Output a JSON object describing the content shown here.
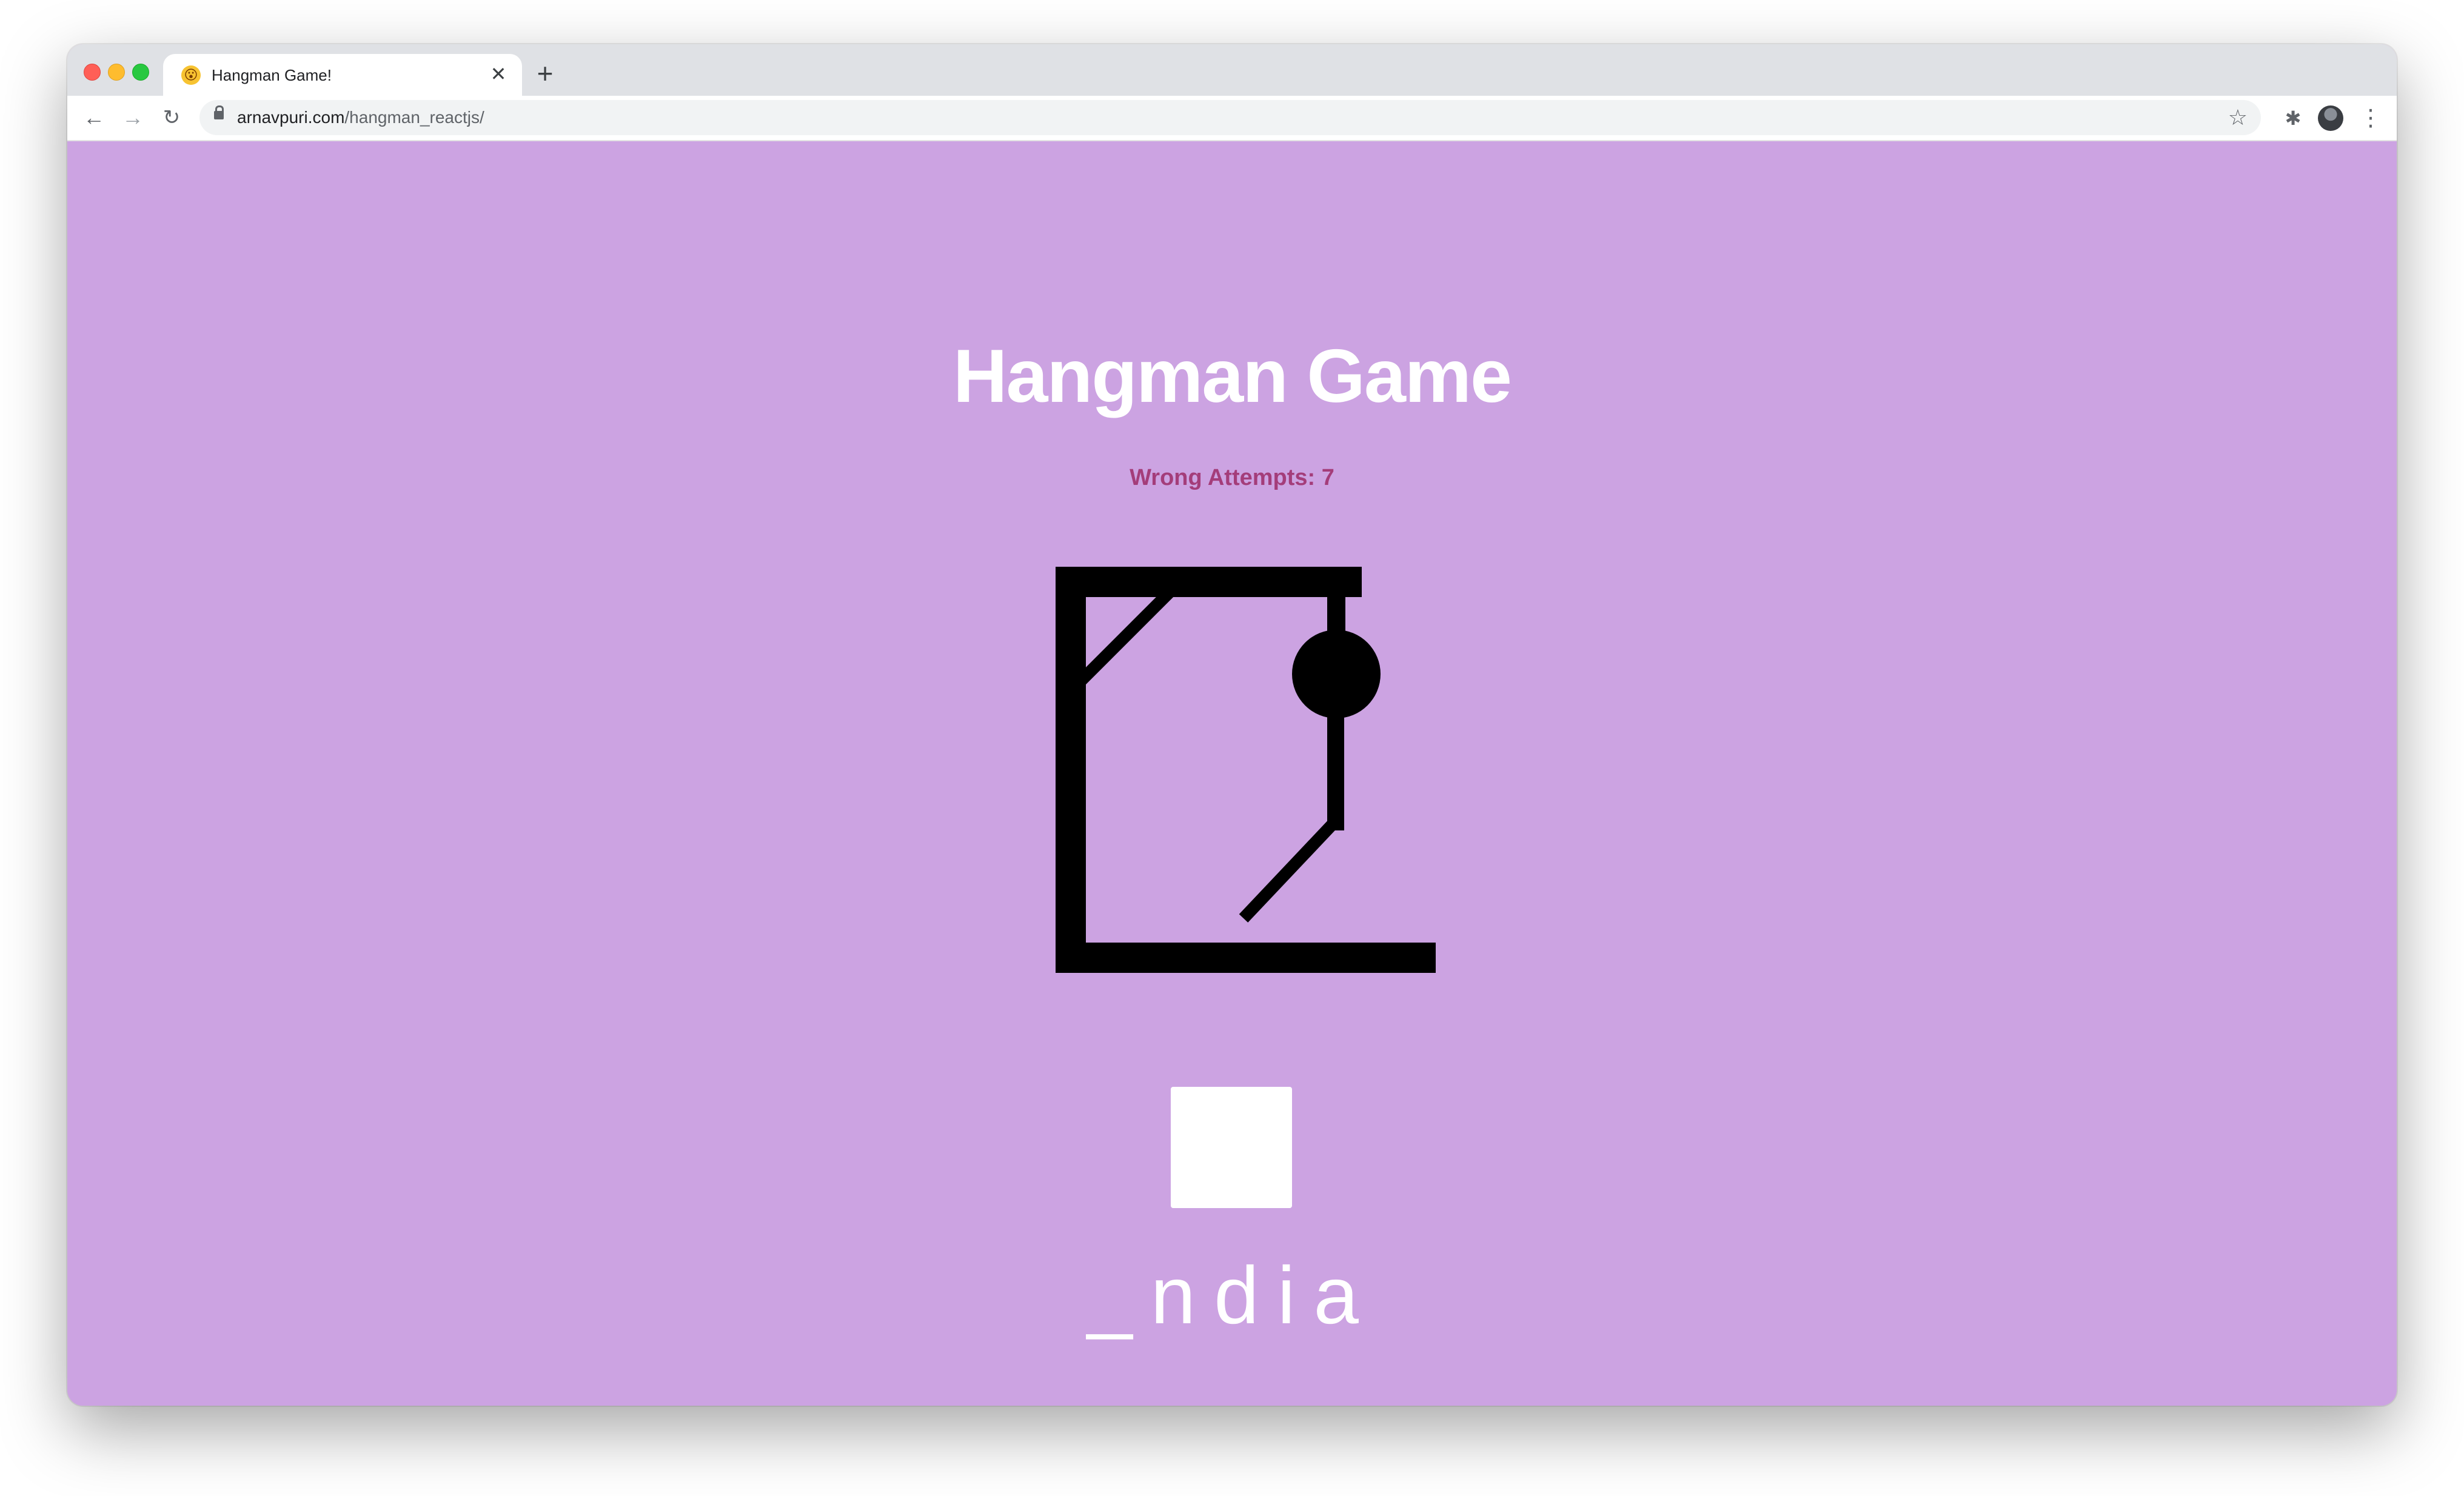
{
  "browser": {
    "tab": {
      "title": "Hangman Game!",
      "favicon": "😮",
      "close_glyph": "✕"
    },
    "new_tab_glyph": "+",
    "nav": {
      "back_glyph": "←",
      "forward_glyph": "→",
      "reload_glyph": "↻"
    },
    "address": {
      "domain": "arnavpuri.com",
      "path": "/hangman_reactjs/"
    },
    "bookmark_glyph": "☆",
    "extensions_glyph": "✱",
    "menu_glyph": "⋮",
    "icons": [
      "back-arrow-icon",
      "forward-arrow-icon",
      "reload-icon",
      "lock-icon",
      "star-icon",
      "puzzle-icon",
      "avatar",
      "kebab-menu-icon"
    ]
  },
  "game": {
    "title": "Hangman Game",
    "wrong_attempts_text": "Wrong Attempts: 7",
    "guess_input_value": "",
    "word_display": "_ndia"
  },
  "colors": {
    "background": "#cca3e2",
    "title": "#ffffff",
    "attempts": "#a43d7a",
    "drawing": "#000000"
  }
}
